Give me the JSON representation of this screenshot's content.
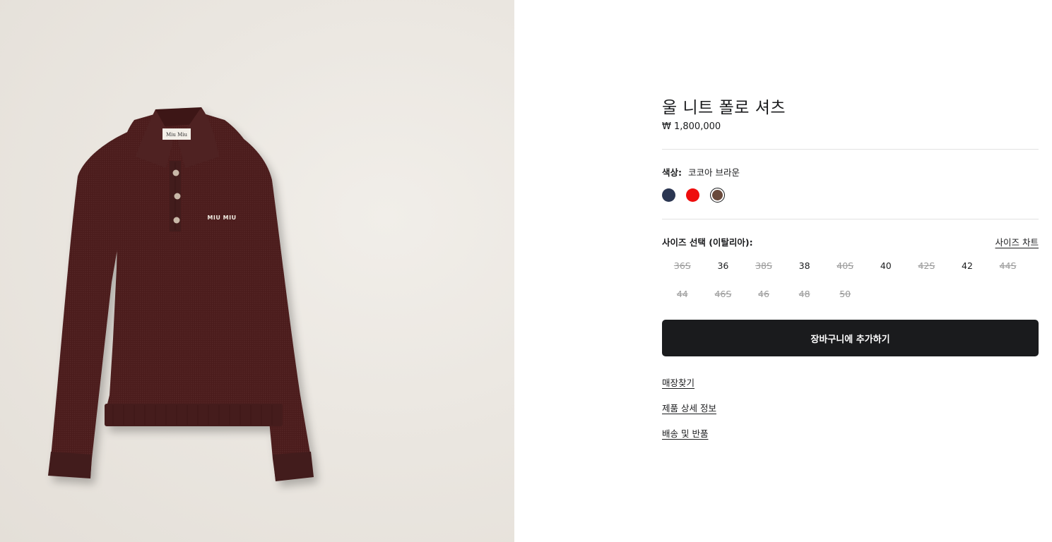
{
  "product": {
    "title": "울 니트 폴로 셔츠",
    "price": "₩ 1,800,000",
    "image_alt": "울 니트 폴로 셔츠",
    "brand_tag": "Miu Miu",
    "chest_logo": "MIU MIU"
  },
  "color": {
    "label": "색상:",
    "value": "코코아 브라운",
    "swatches": [
      {
        "name": "navy",
        "hex": "#2b3652",
        "selected": false
      },
      {
        "name": "red",
        "hex": "#ee0d0d",
        "selected": false
      },
      {
        "name": "cocoa-brown",
        "hex": "#6a4a3c",
        "selected": true
      }
    ]
  },
  "size": {
    "label": "사이즈 선택 (이탈리아):",
    "chart_link": "사이즈 차트",
    "options": [
      {
        "label": "36S",
        "available": false
      },
      {
        "label": "36",
        "available": true
      },
      {
        "label": "38S",
        "available": false
      },
      {
        "label": "38",
        "available": true
      },
      {
        "label": "40S",
        "available": false
      },
      {
        "label": "40",
        "available": true
      },
      {
        "label": "42S",
        "available": false
      },
      {
        "label": "42",
        "available": true
      },
      {
        "label": "44S",
        "available": false
      },
      {
        "label": "44",
        "available": false
      },
      {
        "label": "46S",
        "available": false
      },
      {
        "label": "46",
        "available": false
      },
      {
        "label": "48",
        "available": false
      },
      {
        "label": "50",
        "available": false
      }
    ]
  },
  "actions": {
    "add_to_cart": "장바구니에 추가하기",
    "find_store": "매장찾기",
    "product_details": "제품 상세 정보",
    "shipping_returns": "배송 및 반품"
  },
  "colors": {
    "button_bg": "#1a1b1d",
    "sweater": "#4a1f1f",
    "panel_bg": "#ebe7e1"
  }
}
